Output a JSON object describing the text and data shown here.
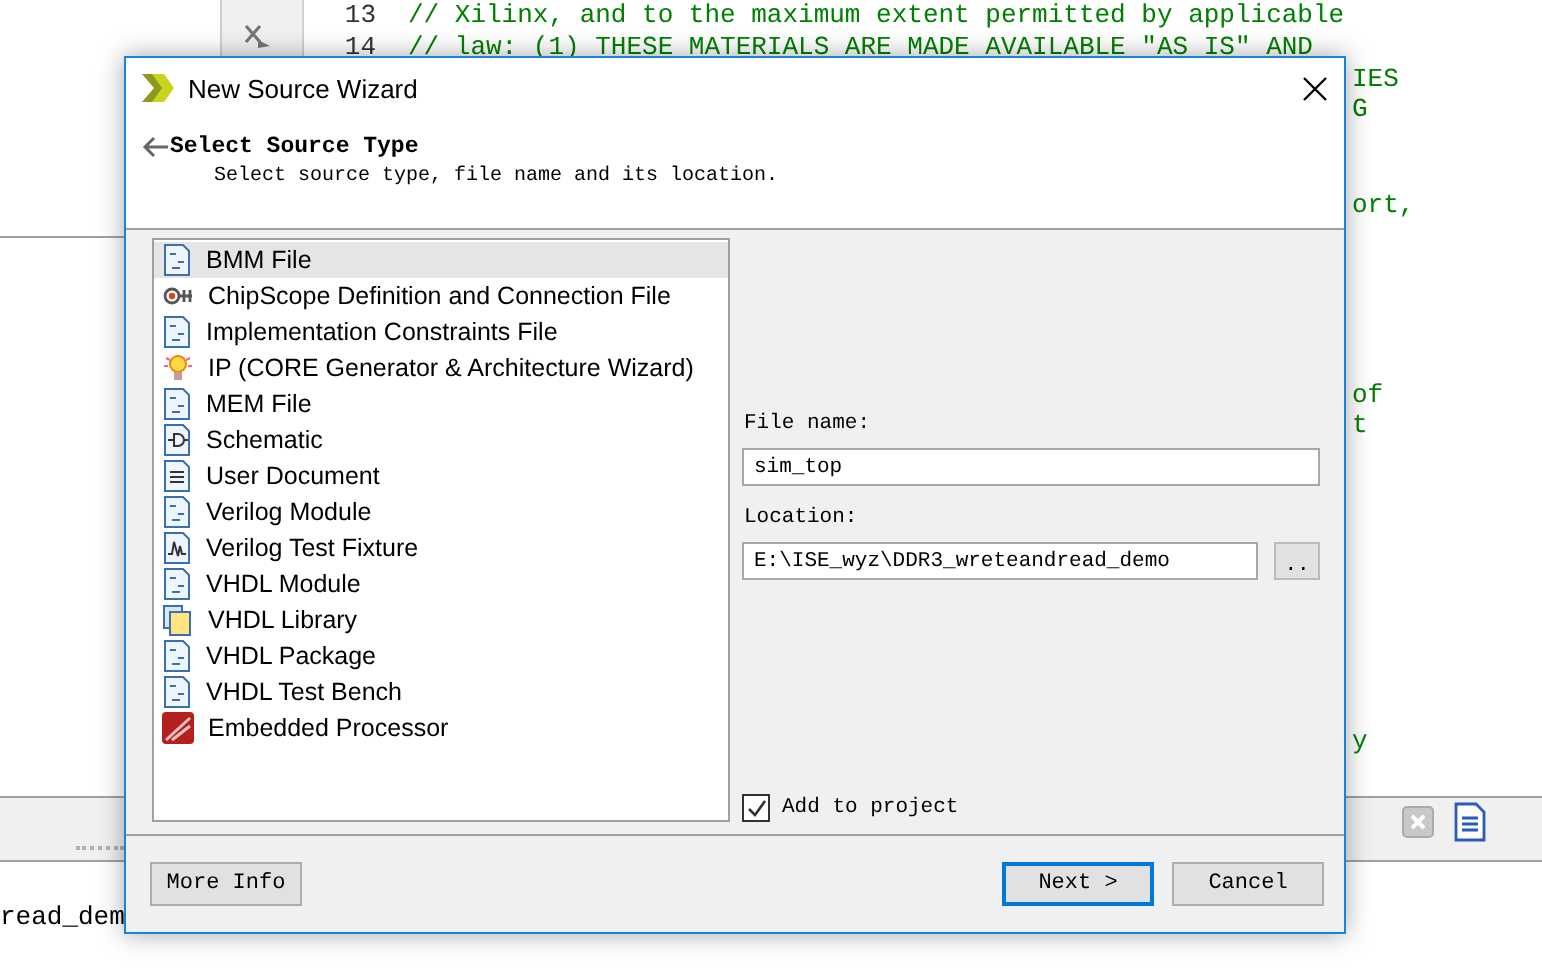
{
  "editor": {
    "lines": [
      {
        "line_number": "13",
        "text": "// Xilinx, and to the maximum extent permitted by applicable"
      },
      {
        "line_number": "14",
        "text": "// law: (1) THESE MATERIALS ARE MADE AVAILABLE \"AS IS\" AND"
      },
      {
        "text": "IES"
      },
      {
        "text": "G"
      },
      {
        "text": "ort,"
      },
      {
        "text": "of"
      },
      {
        "text": "t"
      },
      {
        "text": "y"
      }
    ]
  },
  "console": {
    "text": "read_dem"
  },
  "dialog": {
    "title": "New Source Wizard",
    "heading": "Select Source Type",
    "subheading": "Select source type, file name and its location.",
    "source_types": [
      {
        "label": "BMM File",
        "selected": true
      },
      {
        "label": "ChipScope Definition and Connection File",
        "selected": false
      },
      {
        "label": "Implementation Constraints File",
        "selected": false
      },
      {
        "label": "IP (CORE Generator & Architecture Wizard)",
        "selected": false
      },
      {
        "label": "MEM File",
        "selected": false
      },
      {
        "label": "Schematic",
        "selected": false
      },
      {
        "label": "User Document",
        "selected": false
      },
      {
        "label": "Verilog Module",
        "selected": false
      },
      {
        "label": "Verilog Test Fixture",
        "selected": false
      },
      {
        "label": "VHDL Module",
        "selected": false
      },
      {
        "label": "VHDL Library",
        "selected": false
      },
      {
        "label": "VHDL Package",
        "selected": false
      },
      {
        "label": "VHDL Test Bench",
        "selected": false
      },
      {
        "label": "Embedded Processor",
        "selected": false
      }
    ],
    "file_name": {
      "label": "File name:",
      "value": "sim_top"
    },
    "location": {
      "label": "Location:",
      "value": "E:\\ISE_wyz\\DDR3_wreteandread_demo",
      "browse_label": ".."
    },
    "add_to_project": {
      "label": "Add to project",
      "checked": true
    },
    "buttons": [
      {
        "label": "More Info",
        "default": false
      },
      {
        "label": "Next >",
        "default": true
      },
      {
        "label": "Cancel",
        "default": false
      }
    ]
  }
}
